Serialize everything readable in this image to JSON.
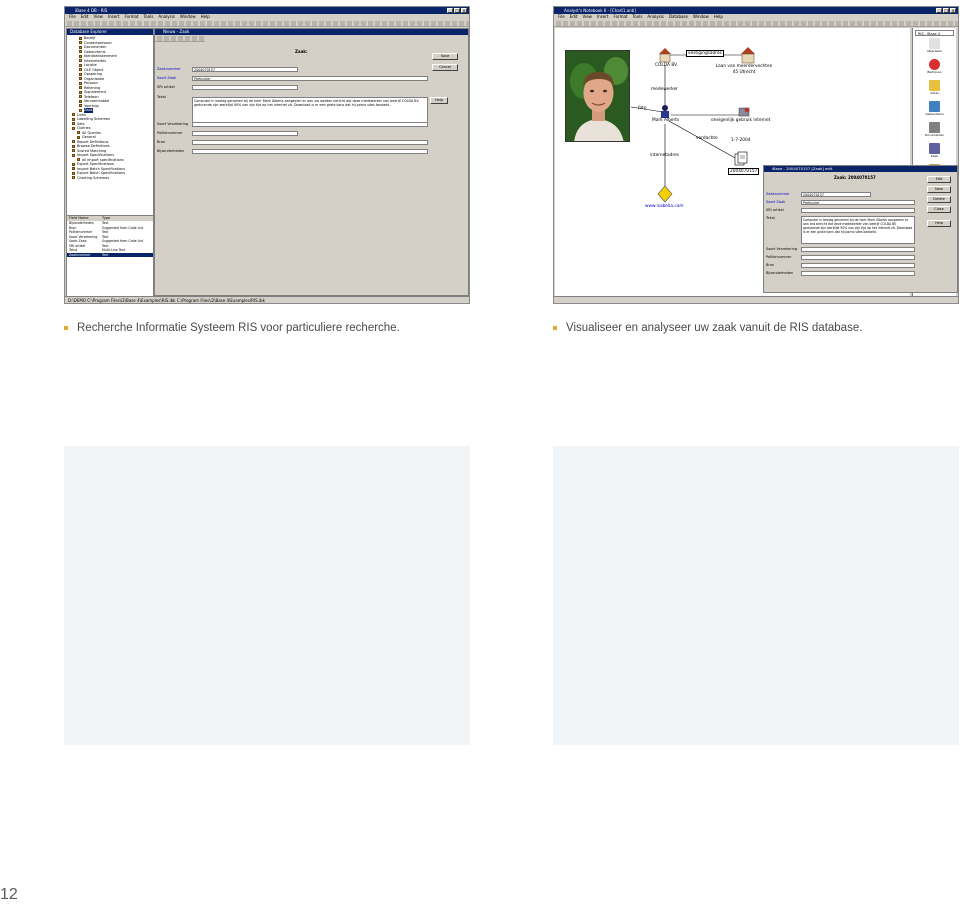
{
  "left_screenshot": {
    "window_title": "iBase 4 DB - RIS",
    "menu": [
      "File",
      "Edit",
      "View",
      "Insert",
      "Format",
      "Tools",
      "Analysis",
      "Window",
      "Help"
    ],
    "explorer_title": "Database Explorer",
    "tree": [
      "Bedrijf",
      "Contactpersoon",
      "Documenten",
      "Gebeurtenis",
      "Identiteitskenmerk",
      "Internetsites",
      "Locatie",
      "OLE Object",
      "Opsporing",
      "Organisatie",
      "Persoon",
      "Rekening",
      "Signalement",
      "Telefoon",
      "Vervoermiddel",
      "Voertuig",
      "Zaak",
      "Links",
      "Labelling Schemes",
      "Sets",
      "Queries",
      "All Queries",
      "General",
      "Report Definitions",
      "Browse Definitions",
      "Scored Matching",
      "Import Specifications",
      "all import specifications",
      "Export Specifications",
      "Import Batch Specifications",
      "Export Batch Specifications",
      "Charting Schemes"
    ],
    "grid_headers": [
      "Field Name",
      "Type"
    ],
    "grid_rows": [
      [
        "Bijzonderheden",
        "Text"
      ],
      [
        "Bron",
        "Suggested from Code List"
      ],
      [
        "Politienummer",
        "Text"
      ],
      [
        "Soort Verzekering",
        "Text"
      ],
      [
        "Soort Zaak",
        "Suggested from Code List"
      ],
      [
        "SRI artikel",
        "Text"
      ],
      [
        "Tekst",
        "Multi-Line Text"
      ],
      [
        "Zaaknummer",
        "Text"
      ]
    ],
    "form_title": "Nieuw - Zaak",
    "form_heading": "Zaak:",
    "fields": [
      {
        "label": "Zaaknummer",
        "value": "2004070157"
      },
      {
        "label": "Soort Zaak",
        "value": "Particulier"
      },
      {
        "label": "SRI artikel",
        "value": ""
      },
      {
        "label": "Tekst",
        "value": "Computer in beslag genomen bij de heer Mark Alberts aangezien er aan uw worden bericht dat deze medewerker van bedrijf COLDA BV gedurende zijn werktijd 90% van zijn tijd op het internet zit. Download is er een grote kans dat hij porno sites bezoekt."
      },
      {
        "label": "Soort Verzekering",
        "value": ""
      },
      {
        "label": "Politienummer",
        "value": ""
      },
      {
        "label": "Bron",
        "value": ""
      },
      {
        "label": "Bijzonderheden",
        "value": ""
      }
    ],
    "buttons": [
      "Save",
      "Cancel",
      "Help"
    ],
    "status": "D:\\DEMO   C:\\Program Files\\i2\\Base 4\\Examples\\RIS.ibk   C:\\Program Files\\i2\\Base 4\\Examples\\RIS.ibk"
  },
  "right_screenshot": {
    "window_title": "Analyst's Notebook 6 - [Chart1.anb]",
    "menu": [
      "File",
      "Edit",
      "View",
      "Insert",
      "Format",
      "Tools",
      "Analysis",
      "Database",
      "Window",
      "Help"
    ],
    "graph_labels": {
      "company": "COLDA BV",
      "establishment": "vestigingsadres",
      "address": "Laan van meerdervechten 45 Utrecht",
      "employee": "medewerker",
      "photo": "foto",
      "person": "Mark Alberts",
      "misuse": "oneigenlijk gebruik internet",
      "suspect": "verdachte",
      "date": "1-7-2004",
      "case": "2004070157",
      "internet_address": "internetadres",
      "website": "www.isabella.com"
    },
    "palette_selector": "RIS - iBase 4",
    "palette_items": [
      "Afspraken",
      "Bedrijven",
      "Adres",
      "Gebeurtenis",
      "Documenten",
      "Zaak",
      "Identiteitsbewijs"
    ],
    "dossier_title": "iBase - 2004070157 [Zaak] edit",
    "dossier_heading": "Zaak: 2004070157",
    "dossier_fields": [
      {
        "label": "Zaaknummer",
        "value": "2004070157"
      },
      {
        "label": "Soort Zaak",
        "value": "Particulier"
      },
      {
        "label": "SRI artikel",
        "value": ""
      },
      {
        "label": "Tekst",
        "value": "Computer in beslag genomen bij de heer Mark Alberts aangezien er aan ons bericht dat deze medewerker van bedrijf COLDA BV gedurende zijn werktijd 90% van zijn tijd op het internet zit. Download is er een grote kans dat hij porno sites bezoekt."
      },
      {
        "label": "Soort Verzekering",
        "value": ""
      },
      {
        "label": "Politienummer",
        "value": ""
      },
      {
        "label": "Bron",
        "value": ""
      },
      {
        "label": "Bijzonderheden",
        "value": ""
      }
    ],
    "dossier_buttons": [
      "Edit",
      "New",
      "Delete",
      "Close",
      "Help"
    ]
  },
  "captions": {
    "left": "Recherche Informatie Systeem RIS voor particuliere recherche.",
    "right": "Visualiseer en analyseer uw zaak vanuit de RIS database."
  },
  "page_number": "12",
  "colors": {
    "bullet": "#e2a92a",
    "panel": "#f2f5f8",
    "caption_text": "#4a4a4a"
  }
}
